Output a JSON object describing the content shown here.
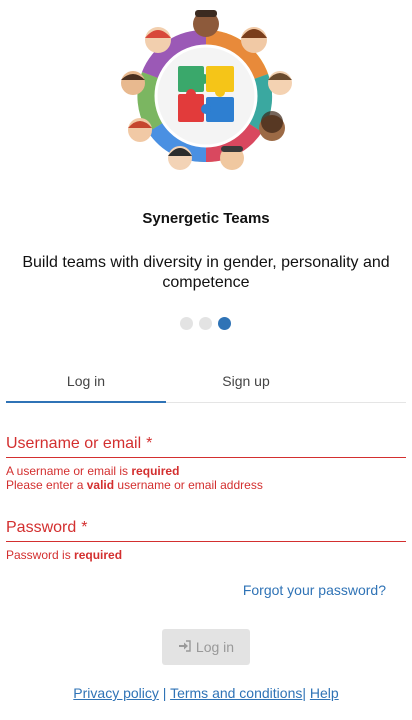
{
  "app": {
    "title": "Synergetic Teams",
    "tagline": "Build teams with diversity in gender, personality and competence"
  },
  "carousel": {
    "page_count": 3,
    "active_index": 2
  },
  "tabs": [
    {
      "label": "Log in",
      "active": true
    },
    {
      "label": "Sign up",
      "active": false
    }
  ],
  "username": {
    "label": "Username or email",
    "required_mark": "*",
    "error1_prefix": "A username or email is ",
    "error1_bold": "required",
    "error2_prefix": "Please enter a ",
    "error2_bold": "valid",
    "error2_suffix": " username or email address"
  },
  "password": {
    "label": "Password",
    "required_mark": "*",
    "error_prefix": "Password is ",
    "error_bold": "required"
  },
  "forgot_password": "Forgot your password?",
  "login_button": {
    "label": "Log in",
    "icon": "sign-in-icon",
    "disabled": true
  },
  "footer": {
    "privacy": "Privacy policy",
    "separator": "|",
    "terms": "Terms and conditions",
    "help": "Help"
  },
  "colors": {
    "accent": "#2f73b6",
    "error": "#d32f2f",
    "disabled_bg": "#e3e3e3",
    "puzzle_green": "#3aa86b",
    "puzzle_yellow": "#f5c518",
    "puzzle_red": "#e23b3b",
    "puzzle_blue": "#2e7fd1"
  }
}
